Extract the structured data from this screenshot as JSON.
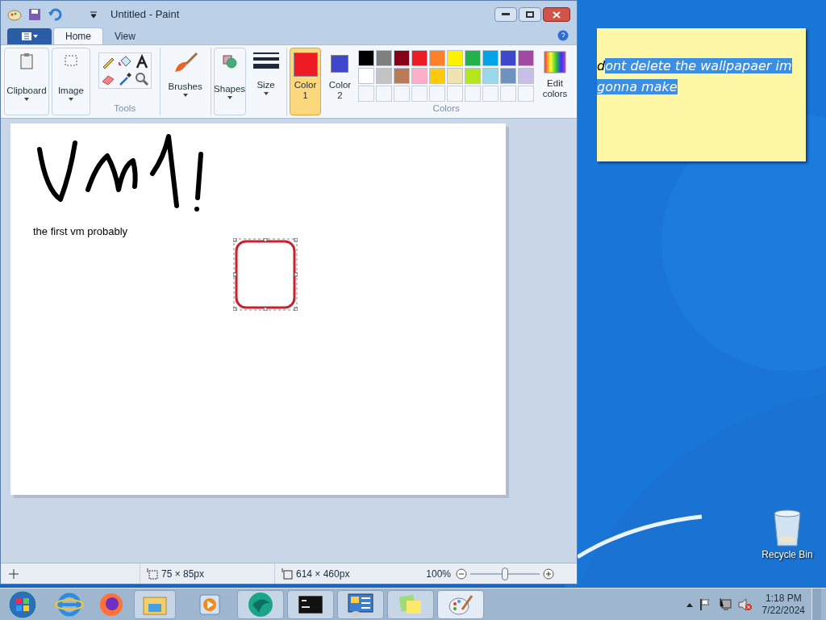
{
  "window": {
    "title": "Untitled - Paint"
  },
  "tabs": [
    {
      "label": "Home",
      "selected": true
    },
    {
      "label": "View",
      "selected": false
    }
  ],
  "ribbon": {
    "clipboard": "Clipboard",
    "image": "Image",
    "tools_label": "Tools",
    "brushes": "Brushes",
    "shapes": "Shapes",
    "size": "Size",
    "color1": {
      "label": "Color\n1",
      "color": "#ed1c24",
      "selected": true
    },
    "color2": {
      "label": "Color\n2",
      "color": "#3f48cc",
      "selected": false
    },
    "palette": [
      {
        "color": "#000000"
      },
      {
        "color": "#7f7f7f"
      },
      {
        "color": "#880015"
      },
      {
        "color": "#ed1c24"
      },
      {
        "color": "#ff7f27"
      },
      {
        "color": "#fff200"
      },
      {
        "color": "#22b14c"
      },
      {
        "color": "#00a2e8"
      },
      {
        "color": "#3f48cc"
      },
      {
        "color": "#a349a4"
      },
      {
        "color": "#ffffff"
      },
      {
        "color": "#c3c3c3"
      },
      {
        "color": "#b97a57"
      },
      {
        "color": "#ffaec9"
      },
      {
        "color": "#ffc90e"
      },
      {
        "color": "#efe4b0"
      },
      {
        "color": "#b5e61d"
      },
      {
        "color": "#99d9ea"
      },
      {
        "color": "#7092be"
      },
      {
        "color": "#c8bfe7"
      }
    ],
    "edit_colors": "Edit\ncolors",
    "colors_label": "Colors"
  },
  "canvas": {
    "text": "the first vm probably"
  },
  "status_bar": {
    "selection_size": "75 × 85px",
    "image_size": "614 × 460px",
    "zoom": "100%",
    "zoom_level": {
      "level": 0.5
    }
  },
  "note": {
    "plain_part": "d",
    "highlighted_part": "ont delete the wallpapaer im gonna make"
  },
  "desktop": {
    "icon": "Recycle Bin"
  },
  "taskbar": {
    "time": "1:18 PM",
    "date": "7/22/2024"
  }
}
